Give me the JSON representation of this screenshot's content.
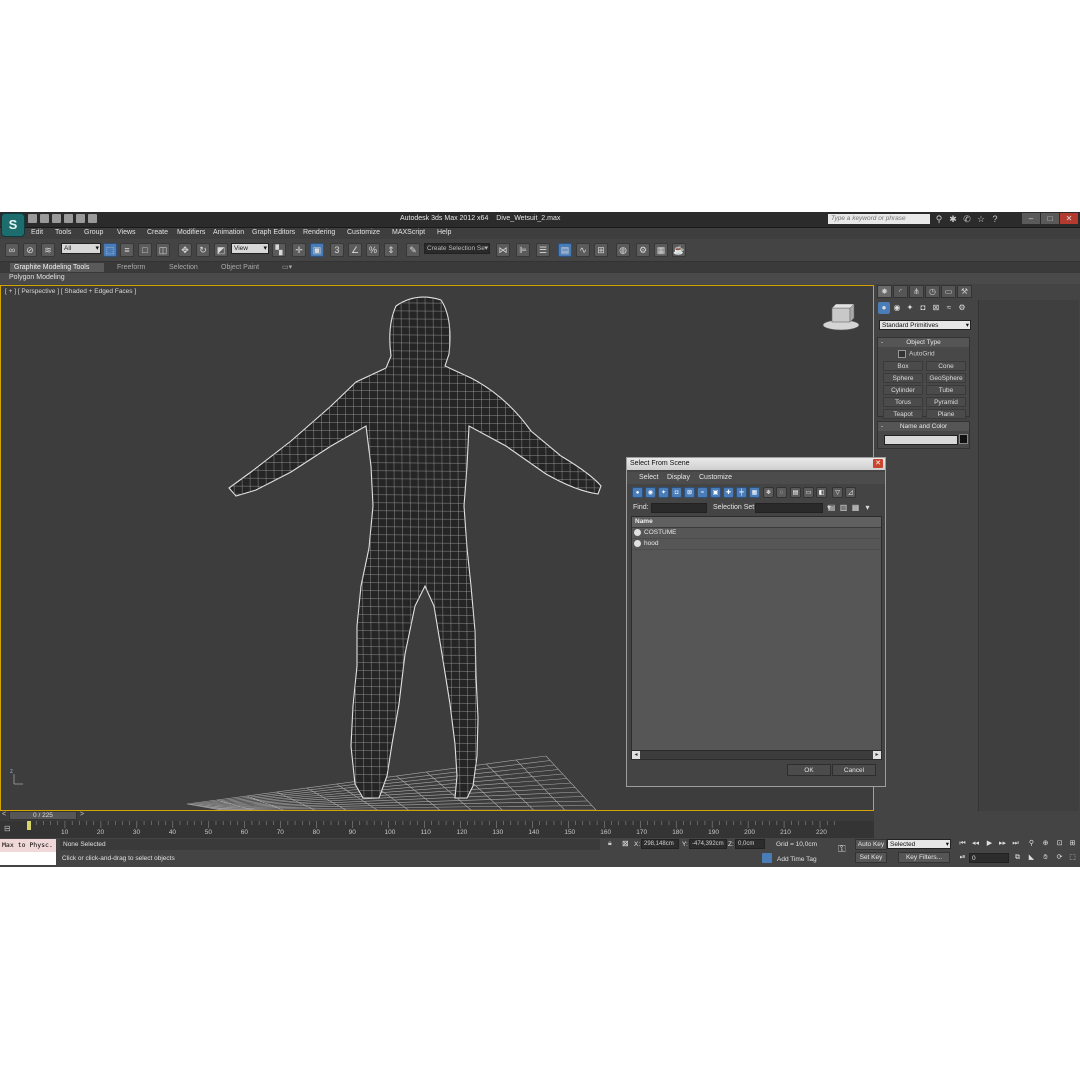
{
  "window": {
    "title": "Autodesk 3ds Max  2012 x64",
    "file": "Dive_Wetsuit_2.max",
    "search_placeholder": "Type a keyword or phrase"
  },
  "menu": [
    "Edit",
    "Tools",
    "Group",
    "Views",
    "Create",
    "Modifiers",
    "Animation",
    "Graph Editors",
    "Rendering",
    "Customize",
    "MAXScript",
    "Help"
  ],
  "toolbar": {
    "filter": "All",
    "ref_coord": "View",
    "selection_set": "Create Selection Se"
  },
  "ribbon": {
    "tabs": [
      "Graphite Modeling Tools",
      "Freeform",
      "Selection",
      "Object Paint"
    ],
    "panel": "Polygon Modeling"
  },
  "viewport": {
    "label": "[ + ] [ Perspective ] [ Shaded + Edged Faces ]"
  },
  "command_panel": {
    "category": "Standard Primitives",
    "object_type_title": "Object Type",
    "autogrid": "AutoGrid",
    "buttons": [
      "Box",
      "Cone",
      "Sphere",
      "GeoSphere",
      "Cylinder",
      "Tube",
      "Torus",
      "Pyramid",
      "Teapot",
      "Plane"
    ],
    "name_color_title": "Name and Color"
  },
  "dialog": {
    "title": "Select From Scene",
    "menu": [
      "Select",
      "Display",
      "Customize"
    ],
    "find_label": "Find:",
    "selection_set_label": "Selection Set:",
    "column": "Name",
    "objects": [
      "COSTUME",
      "hood"
    ],
    "ok": "OK",
    "cancel": "Cancel"
  },
  "timeline": {
    "frame_display": "0 / 225",
    "ticks": [
      10,
      20,
      30,
      40,
      50,
      60,
      70,
      80,
      90,
      100,
      110,
      120,
      130,
      140,
      150,
      160,
      170,
      180,
      190,
      200,
      210,
      220
    ],
    "total_frames": 225
  },
  "status": {
    "maxscript": "Max to Physc.",
    "selection": "None Selected",
    "prompt": "Click or click-and-drag to select objects",
    "x_label": "X:",
    "x": "298,148cm",
    "y_label": "Y:",
    "y": "-474,392cm",
    "z_label": "Z:",
    "z": "0,0cm",
    "grid": "Grid = 10,0cm",
    "add_time_tag": "Add Time Tag",
    "auto_key": "Auto Key",
    "set_key": "Set Key",
    "key_mode": "Selected",
    "key_filters": "Key Filters...",
    "current_frame": "0"
  },
  "colors": {
    "ui_bg": "#444444",
    "viewport_bg": "#3d3d3d",
    "active_border": "#d3a500",
    "accent_blue": "#4a7db8"
  }
}
